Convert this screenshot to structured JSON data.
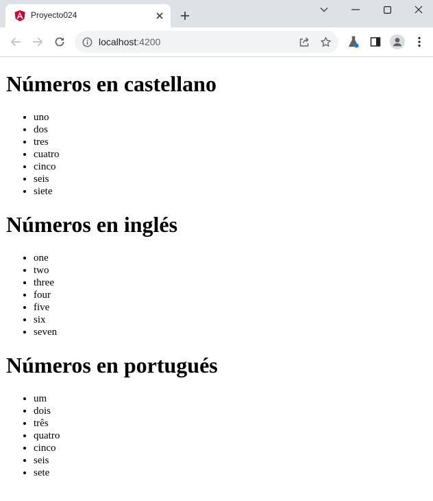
{
  "browser": {
    "tab_title": "Proyecto024",
    "url_host": "localhost",
    "url_port": ":4200",
    "accent": "#dd0031"
  },
  "page": {
    "sections": [
      {
        "heading": "Números en castellano",
        "items": [
          "uno",
          "dos",
          "tres",
          "cuatro",
          "cinco",
          "seis",
          "siete"
        ]
      },
      {
        "heading": "Números en inglés",
        "items": [
          "one",
          "two",
          "three",
          "four",
          "five",
          "six",
          "seven"
        ]
      },
      {
        "heading": "Números en portugués",
        "items": [
          "um",
          "dois",
          "três",
          "quatro",
          "cinco",
          "seis",
          "sete"
        ]
      }
    ]
  }
}
